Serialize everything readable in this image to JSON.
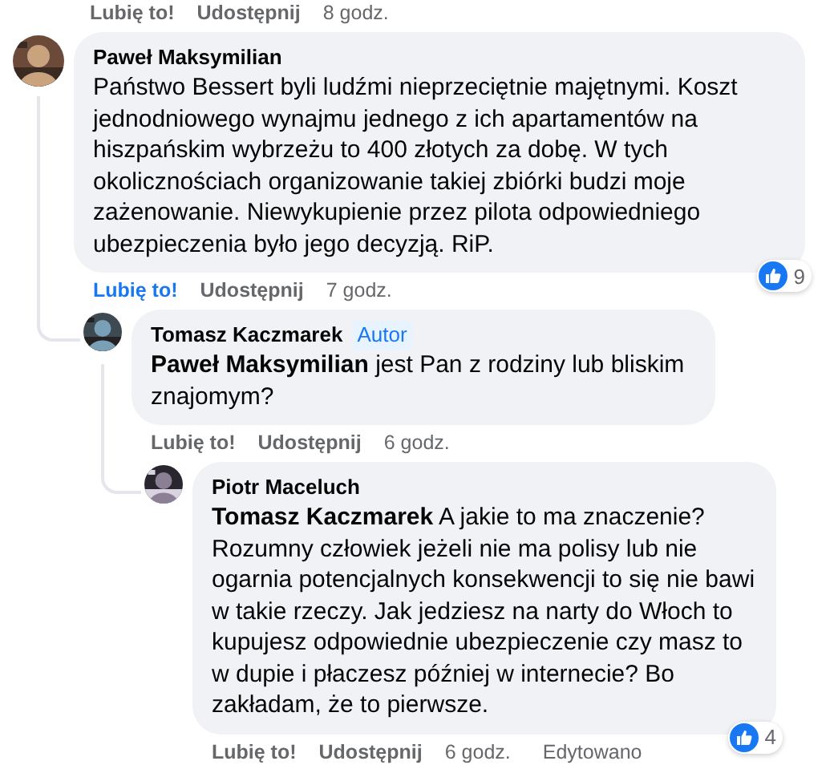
{
  "previous_actions": {
    "like": "Lubię to!",
    "share": "Udostępnij",
    "time": "8 godz."
  },
  "comments": [
    {
      "author": "Paweł Maksymilian",
      "text": "Państwo Bessert byli ludźmi nieprzeciętnie majętnymi. Koszt jednodniowego wynajmu jednego z ich apartamentów na hiszpańskim wybrzeżu to 400 złotych za dobę. W tych okolicznościach organizowanie takiej zbiórki budzi moje zażenowanie. Niewykupienie przez pilota odpowiedniego ubezpieczenia było jego decyzją. RiP.",
      "like": "Lubię to!",
      "liked": true,
      "share": "Udostępnij",
      "time": "7 godz.",
      "reactions": "9",
      "children": [
        {
          "author": "Tomasz Kaczmarek",
          "badge": "Autor",
          "text": "**Paweł Maksymilian** jest Pan z rodziny lub bliskim znajomym?",
          "like": "Lubię to!",
          "liked": false,
          "share": "Udostępnij",
          "time": "6 godz.",
          "children": [
            {
              "author": "Piotr Maceluch",
              "text": "**Tomasz Kaczmarek** A jakie to ma znaczenie? Rozumny człowiek jeżeli nie ma polisy lub nie ogarnia potencjalnych konsekwencji to się nie bawi w takie rzeczy. Jak jedziesz na narty do Włoch to kupujesz odpowiednie ubezpieczenie czy masz to w dupie i płaczesz później w internecie? Bo zakładam, że to pierwsze.",
              "like": "Lubię to!",
              "liked": false,
              "share": "Udostępnij",
              "time": "6 godz.",
              "edited": "Edytowano",
              "reactions": "4"
            }
          ]
        }
      ]
    }
  ]
}
